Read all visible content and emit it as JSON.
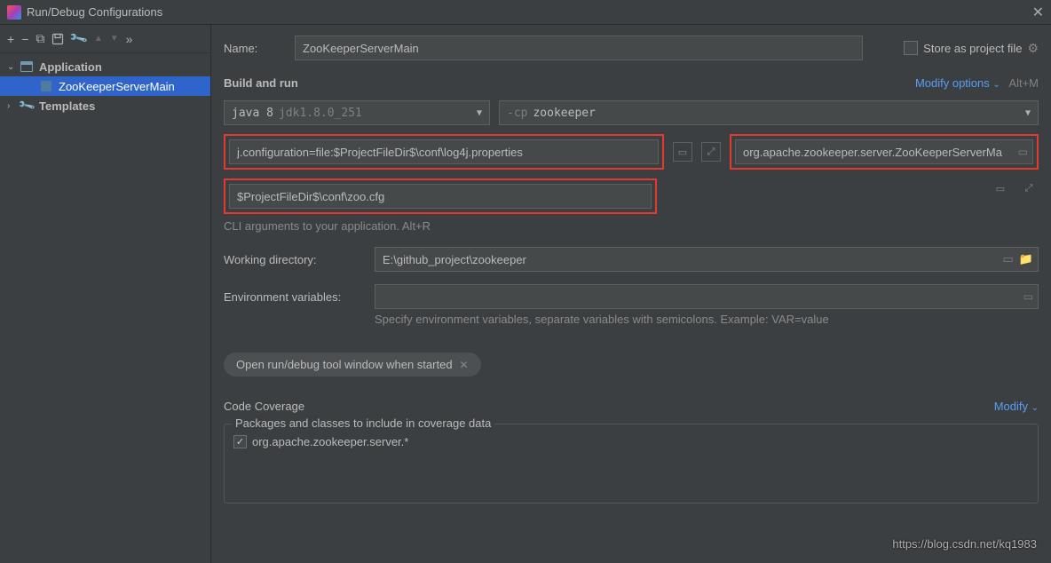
{
  "window": {
    "title": "Run/Debug Configurations"
  },
  "toolbar": {
    "add": "+",
    "remove": "−",
    "copy": "⧉",
    "save": "▭",
    "wrench": "🔧",
    "up": "▲",
    "down": "▼",
    "more": "»"
  },
  "tree": {
    "application": "Application",
    "config": "ZooKeeperServerMain",
    "templates": "Templates"
  },
  "form": {
    "name_label": "Name:",
    "name_value": "ZooKeeperServerMain",
    "store_label": "Store as project file"
  },
  "build": {
    "title": "Build and run",
    "modify": "Modify options",
    "modify_shortcut": "Alt+M",
    "java_label": "java 8",
    "jdk_hint": "jdk1.8.0_251",
    "cp_prefix": "-cp",
    "cp_value": "zookeeper",
    "vm_options": "j.configuration=file:$ProjectFileDir$\\conf\\log4j.properties",
    "main_class": "org.apache.zookeeper.server.ZooKeeperServerMa",
    "program_args": "$ProjectFileDir$\\conf\\zoo.cfg",
    "cli_hint": "CLI arguments to your application. Alt+R",
    "wd_label": "Working directory:",
    "wd_value": "E:\\github_project\\zookeeper",
    "env_label": "Environment variables:",
    "env_value": "",
    "env_hint": "Specify environment variables, separate variables with semicolons. Example: VAR=value",
    "chip_label": "Open run/debug tool window when started"
  },
  "coverage": {
    "title": "Code Coverage",
    "modify": "Modify",
    "legend": "Packages and classes to include in coverage data",
    "item": "org.apache.zookeeper.server.*"
  },
  "watermark": "https://blog.csdn.net/kq1983"
}
